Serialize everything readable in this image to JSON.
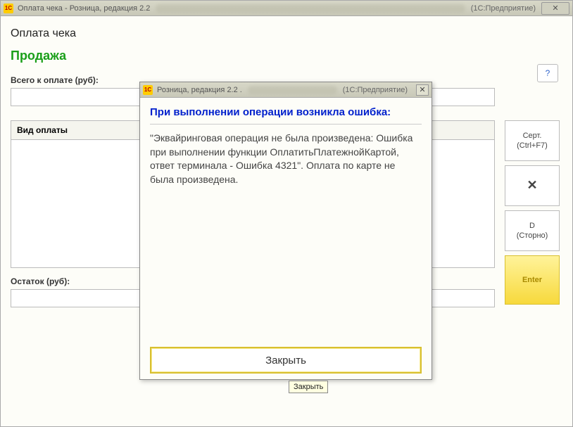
{
  "mainTitlebar": {
    "title": "Оплата чека - Розница, редакция 2.2",
    "right": "(1С:Предприятие)",
    "icon": "1С"
  },
  "page": {
    "title": "Оплата чека",
    "subtitle": "Продажа"
  },
  "helpIcon": "?",
  "fields": {
    "totalLabel": "Всего к оплате (руб):",
    "paymentTypeLabel": "Вид оплаты",
    "remainderLabel": "Остаток (руб):"
  },
  "buttons": {
    "cert": {
      "line1": "Серт.",
      "line2": "(Ctrl+F7)"
    },
    "cancel": "✕",
    "storno": {
      "line1": "D",
      "line2": "(Сторно)"
    },
    "enter": "Enter"
  },
  "modal": {
    "titlebar": {
      "title": "Розница, редакция 2.2 .",
      "right": "(1С:Предприятие)",
      "icon": "1С"
    },
    "heading": "При выполнении операции возникла ошибка:",
    "body": "\"Эквайринговая операция не была произведена: Ошибка при выполнении функции ОплатитьПлатежнойКартой, ответ терминала - Ошибка 4321\".\nОплата по карте не была произведена.",
    "closeLabel": "Закрыть"
  },
  "tooltip": "Закрыть"
}
